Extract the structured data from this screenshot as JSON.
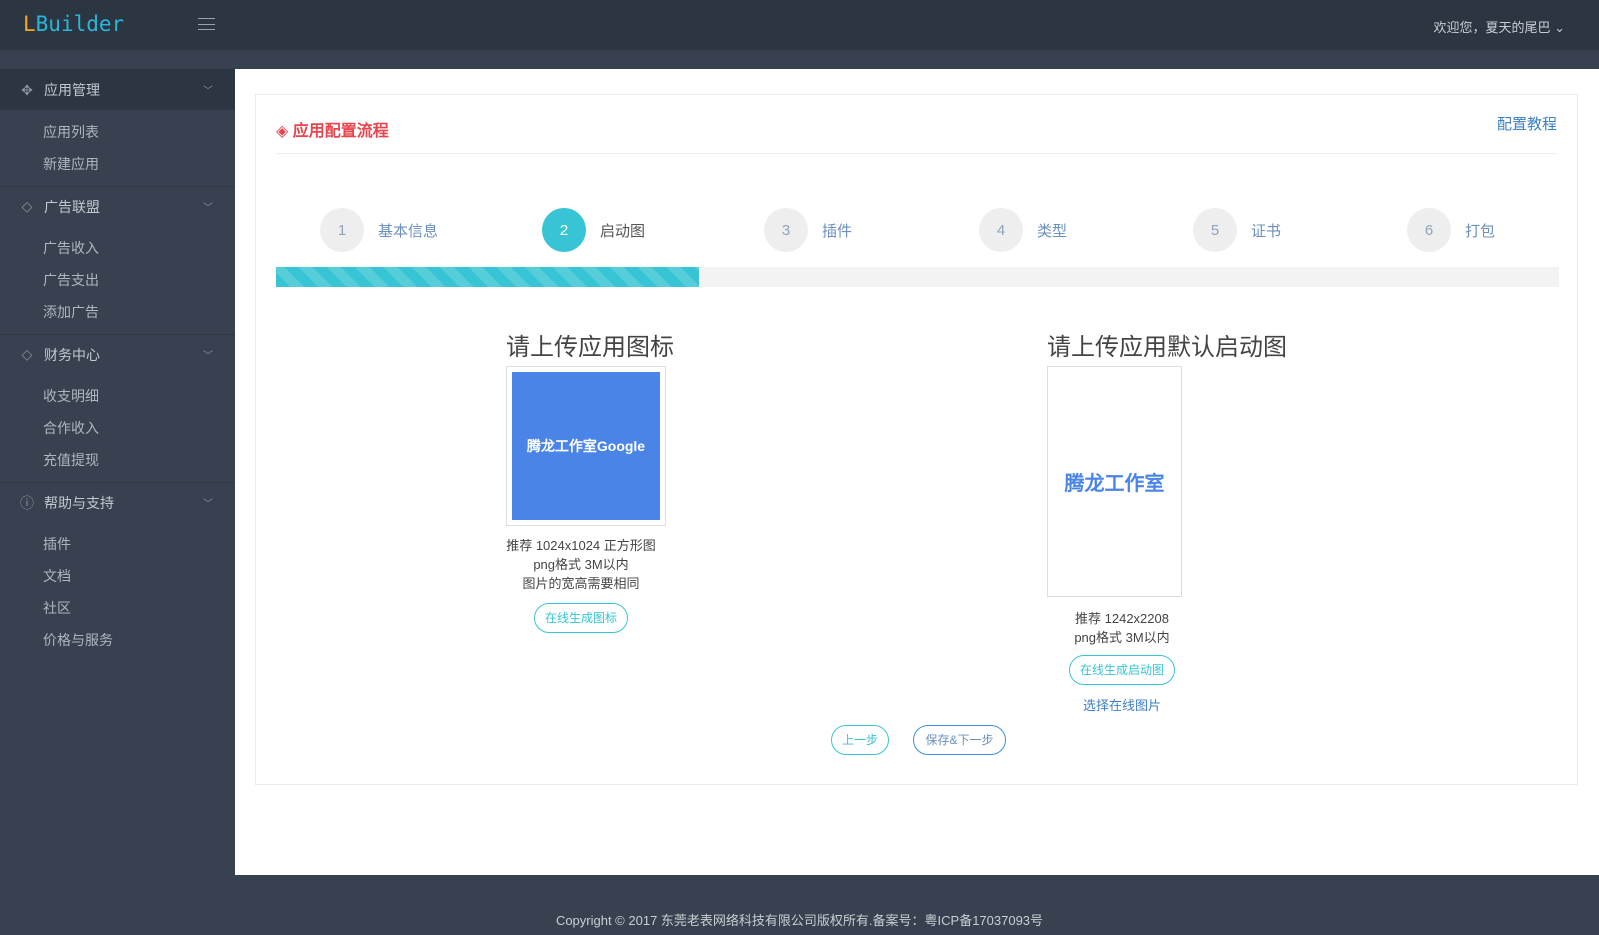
{
  "header": {
    "logo_first": "L",
    "logo_rest": "Builder",
    "user": "欢迎您，夏天的尾巴"
  },
  "sidebar": {
    "groups": [
      {
        "label": "应用管理",
        "icon": "puzzle-icon",
        "items": [
          "应用列表",
          "新建应用"
        ]
      },
      {
        "label": "广告联盟",
        "icon": "diamond-icon",
        "items": [
          "广告收入",
          "广告支出",
          "添加广告"
        ]
      },
      {
        "label": "财务中心",
        "icon": "diamond-icon",
        "items": [
          "收支明细",
          "合作收入",
          "充值提现"
        ]
      },
      {
        "label": "帮助与支持",
        "icon": "question-icon",
        "items": [
          "插件",
          "文档",
          "社区",
          "价格与服务"
        ]
      }
    ]
  },
  "card": {
    "title": "应用配置流程",
    "link": "配置教程"
  },
  "steps": [
    {
      "num": "1",
      "label": "基本信息"
    },
    {
      "num": "2",
      "label": "启动图"
    },
    {
      "num": "3",
      "label": "插件"
    },
    {
      "num": "4",
      "label": "类型"
    },
    {
      "num": "5",
      "label": "证书"
    },
    {
      "num": "6",
      "label": "打包"
    }
  ],
  "active_step": 2,
  "progress_percent": 33,
  "icon_upload": {
    "title": "请上传应用图标",
    "image_text": "腾龙工作室Google",
    "hints": [
      "推荐 1024x1024 正方形图",
      "png格式 3M以内",
      "图片的宽高需要相同"
    ],
    "button": "在线生成图标"
  },
  "splash_upload": {
    "title": "请上传应用默认启动图",
    "image_text": "腾龙工作室",
    "hints": [
      "推荐 1242x2208",
      "png格式 3M以内"
    ],
    "button": "在线生成启动图",
    "link": "选择在线图片"
  },
  "actions": {
    "prev": "上一步",
    "next": "保存&下一步"
  },
  "footer": "Copyright © 2017 东莞老表网络科技有限公司版权所有.备案号：粤ICP备17037093号",
  "colors": {
    "accent": "#37c4d4",
    "title_red": "#e8454e",
    "link_blue": "#3d7fc4",
    "sidebar": "#37414f",
    "topbar": "#2c3542"
  }
}
